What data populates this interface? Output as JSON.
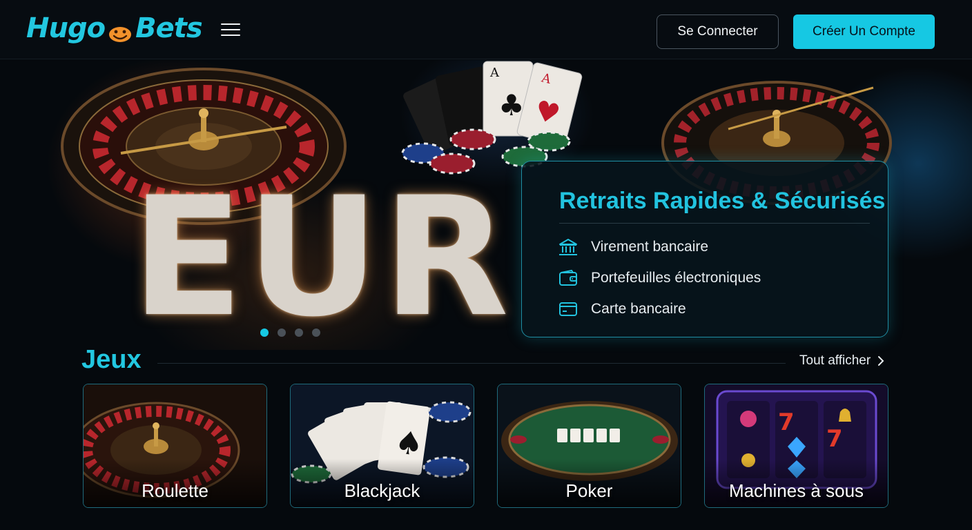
{
  "header": {
    "logo_left": "Hugo",
    "logo_right": "Bets",
    "login_label": "Se Connecter",
    "register_label": "Créer Un Compte"
  },
  "hero": {
    "big_text": "EUR",
    "panel": {
      "title": "Retraits Rapides & Sécurisés",
      "methods": [
        {
          "label": "Virement bancaire",
          "icon": "bank-icon"
        },
        {
          "label": "Portefeuilles électroniques",
          "icon": "wallet-icon"
        },
        {
          "label": "Carte bancaire",
          "icon": "credit-card-icon"
        }
      ]
    },
    "carousel": {
      "slides": 4,
      "active": 1
    }
  },
  "games": {
    "title": "Jeux",
    "see_all": "Tout afficher",
    "items": [
      {
        "label": "Roulette"
      },
      {
        "label": "Blackjack"
      },
      {
        "label": "Poker"
      },
      {
        "label": "Machines à sous"
      }
    ]
  },
  "colors": {
    "accent": "#16c8e3",
    "background": "#05090d",
    "logo_face": "#f2912b"
  }
}
